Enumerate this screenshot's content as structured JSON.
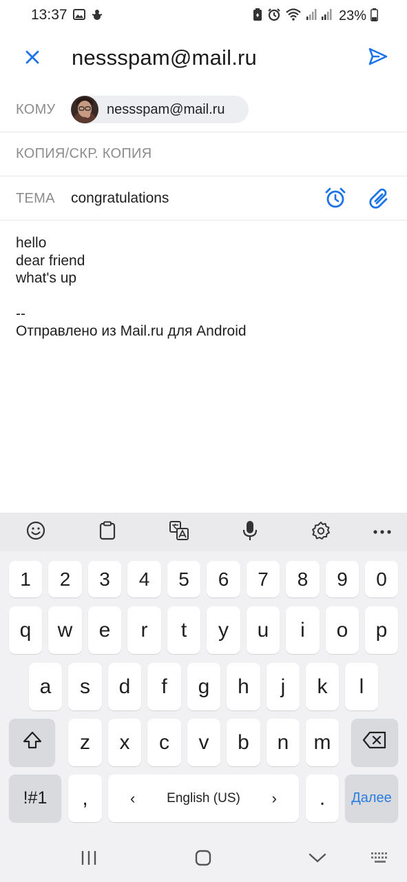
{
  "status_bar": {
    "time": "13:37",
    "battery_pct": "23%",
    "icons": [
      "image-icon",
      "bug-icon",
      "battery-saver-icon",
      "alarm-icon",
      "wifi-icon",
      "signal-icon",
      "signal-icon",
      "battery-icon"
    ]
  },
  "header": {
    "title": "nessspam@mail.ru",
    "close_icon": "close-icon",
    "send_icon": "send-icon"
  },
  "fields": {
    "to_label": "КОМУ",
    "to_recipient": "nessspam@mail.ru",
    "cc_label": "КОПИЯ/СКР. КОПИЯ",
    "subject_label": "ТЕМА",
    "subject_value": "congratulations"
  },
  "body": {
    "lines": [
      "hello",
      "dear friend",
      "what's up",
      "",
      "--",
      "Отправлено из Mail.ru для Android"
    ]
  },
  "keyboard": {
    "toolbar": [
      "emoji-icon",
      "clipboard-icon",
      "translate-icon",
      "mic-icon",
      "settings-icon",
      "more-icon"
    ],
    "number_row": [
      "1",
      "2",
      "3",
      "4",
      "5",
      "6",
      "7",
      "8",
      "9",
      "0"
    ],
    "row1": [
      "q",
      "w",
      "e",
      "r",
      "t",
      "y",
      "u",
      "i",
      "o",
      "p"
    ],
    "row2": [
      "a",
      "s",
      "d",
      "f",
      "g",
      "h",
      "j",
      "k",
      "l"
    ],
    "row3": [
      "z",
      "x",
      "c",
      "v",
      "b",
      "n",
      "m"
    ],
    "symbols_label": "!#1",
    "comma_label": ",",
    "language_label": "English (US)",
    "period_label": ".",
    "enter_label": "Далее"
  },
  "colors": {
    "accent": "#1a73e8",
    "chip_bg": "#eceef1",
    "label_gray": "#8c8c8c"
  }
}
